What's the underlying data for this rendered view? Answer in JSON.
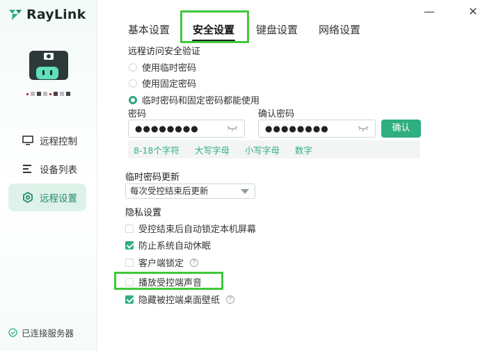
{
  "app": {
    "name": "RayLink",
    "accent": "#2fae7f",
    "highlight": "#3ec83a"
  },
  "sidebar": {
    "items": [
      {
        "label": "远程控制",
        "icon": "monitor-icon"
      },
      {
        "label": "设备列表",
        "icon": "list-icon"
      },
      {
        "label": "远程设置",
        "icon": "settings-icon",
        "active": true
      }
    ],
    "status": "已连接服务器"
  },
  "window": {
    "minimize": "—",
    "close": "✕"
  },
  "tabs": [
    {
      "label": "基本设置"
    },
    {
      "label": "安全设置",
      "active": true
    },
    {
      "label": "键盘设置"
    },
    {
      "label": "网络设置"
    }
  ],
  "security": {
    "title": "远程访问安全验证",
    "options": [
      {
        "label": "使用临时密码",
        "selected": false
      },
      {
        "label": "使用固定密码",
        "selected": false
      },
      {
        "label": "临时密码和固定密码都能使用",
        "selected": true
      }
    ],
    "password_label": "密码",
    "password_value": "●●●●●●●●",
    "confirm_label": "确认密码",
    "confirm_value": "●●●●●●●●",
    "confirm_button": "确认",
    "rules": [
      "8-18个字符",
      "大写字母",
      "小写字母",
      "数字"
    ]
  },
  "temp_password": {
    "title": "临时密码更新",
    "selected": "每次受控结束后更新"
  },
  "privacy": {
    "title": "隐私设置",
    "items": [
      {
        "label": "受控结束后自动锁定本机屏幕",
        "checked": false
      },
      {
        "label": "防止系统自动休眠",
        "checked": true
      },
      {
        "label": "客户端锁定",
        "checked": false,
        "help": "?"
      },
      {
        "label": "播放受控端声音",
        "checked": false
      },
      {
        "label": "隐藏被控端桌面壁纸",
        "checked": true,
        "help": "?"
      }
    ]
  }
}
